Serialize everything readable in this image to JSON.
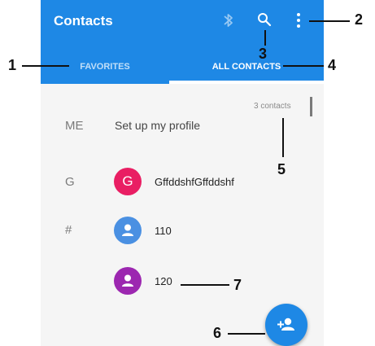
{
  "appbar": {
    "title": "Contacts",
    "icons": [
      "bluetooth-icon",
      "search-icon",
      "more-vert-icon"
    ],
    "color": "#1e88e5"
  },
  "tabs": [
    {
      "label": "FAVORITES",
      "selected": false
    },
    {
      "label": "ALL CONTACTS",
      "selected": true
    }
  ],
  "list": {
    "count_label": "3 contacts",
    "me": {
      "section": "ME",
      "label": "Set up my profile"
    },
    "contacts": [
      {
        "section": "G",
        "avatar_letter": "G",
        "avatar_color": "#e91e63",
        "name": "GffddshfGffddshf"
      },
      {
        "section": "#",
        "avatar_letter": "",
        "avatar_color": "#4a90e2",
        "name": "110"
      },
      {
        "section": "",
        "avatar_letter": "",
        "avatar_color": "#9c27b0",
        "name": "120"
      }
    ]
  },
  "fab": {
    "icon": "add-person-icon",
    "color": "#1e88e5"
  },
  "callouts": [
    "1",
    "2",
    "3",
    "4",
    "5",
    "6",
    "7"
  ]
}
